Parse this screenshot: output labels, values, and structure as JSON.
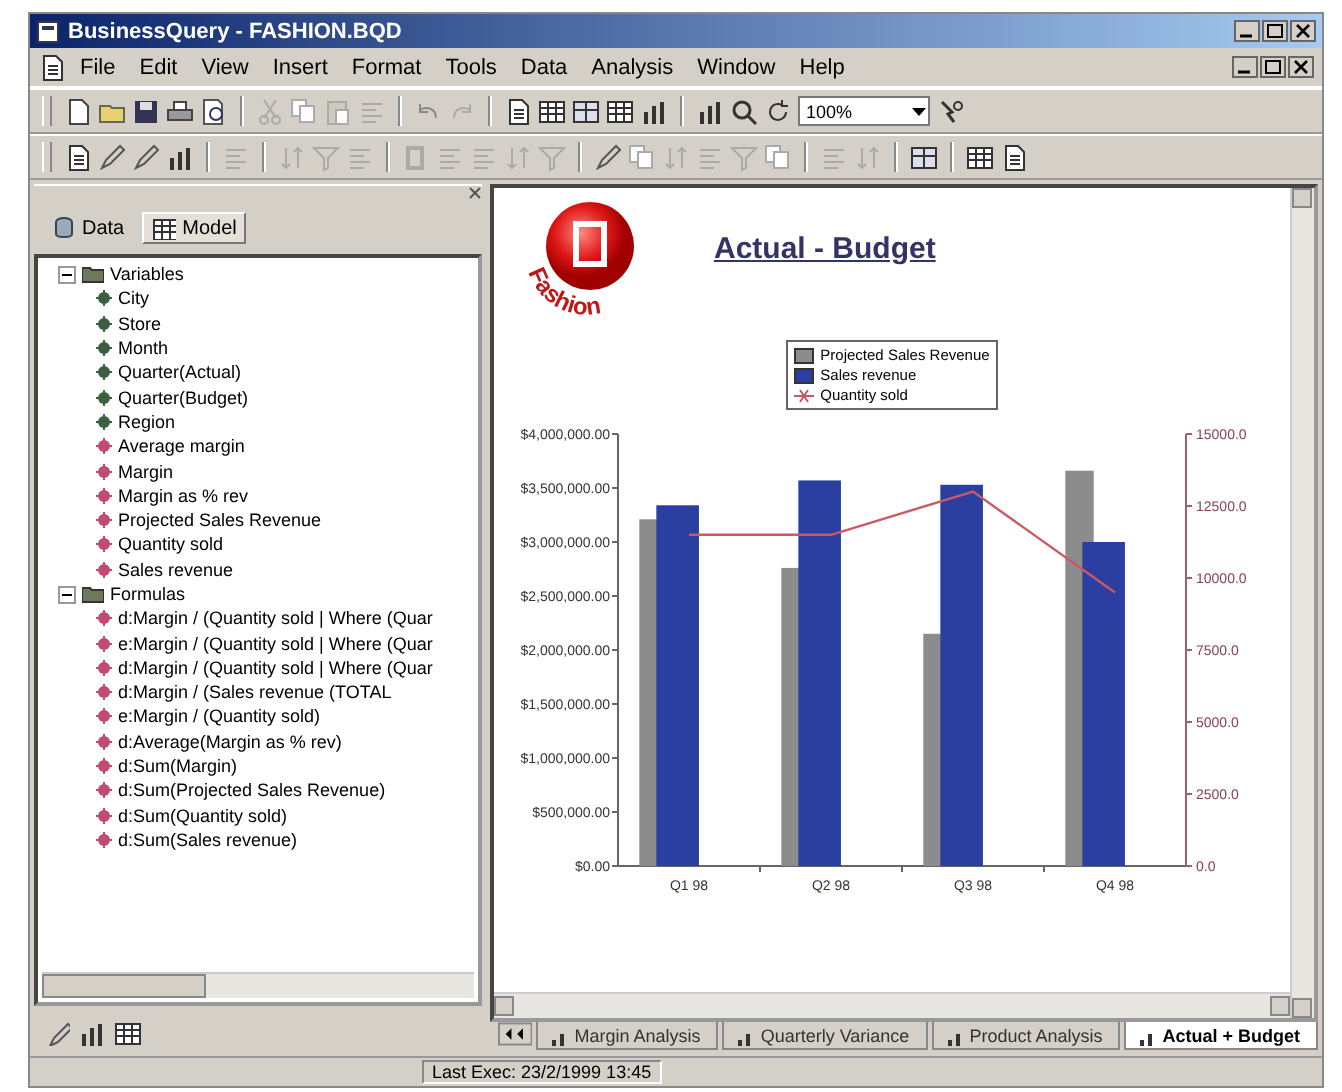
{
  "window": {
    "title": "BusinessQuery - FASHION.BQD"
  },
  "menu": [
    "File",
    "Edit",
    "View",
    "Insert",
    "Format",
    "Tools",
    "Data",
    "Analysis",
    "Window",
    "Help"
  ],
  "toolbar": {
    "zoom": "100%"
  },
  "panel": {
    "tabs": [
      {
        "label": "Data",
        "selected": false
      },
      {
        "label": "Model",
        "selected": true
      }
    ],
    "tree": [
      {
        "label": "Variables",
        "expanded": true,
        "children": [
          {
            "label": "City",
            "kind": "dimension"
          },
          {
            "label": "Store",
            "kind": "dimension"
          },
          {
            "label": "Month",
            "kind": "dimension"
          },
          {
            "label": "Quarter(Actual)",
            "kind": "dimension"
          },
          {
            "label": "Quarter(Budget)",
            "kind": "dimension"
          },
          {
            "label": "Region",
            "kind": "dimension"
          },
          {
            "label": "Average margin",
            "kind": "measure"
          },
          {
            "label": "Margin",
            "kind": "measure"
          },
          {
            "label": "Margin as % rev",
            "kind": "measure"
          },
          {
            "label": "Projected Sales Revenue",
            "kind": "measure"
          },
          {
            "label": "Quantity sold",
            "kind": "measure"
          },
          {
            "label": "Sales revenue",
            "kind": "measure"
          }
        ]
      },
      {
        "label": "Formulas",
        "expanded": true,
        "children": [
          {
            "label": "d:Margin / (Quantity sold | Where (Quar",
            "kind": "measure"
          },
          {
            "label": "e:Margin / (Quantity sold | Where (Quar",
            "kind": "measure"
          },
          {
            "label": "d:Margin / (Quantity sold | Where (Quar",
            "kind": "measure"
          },
          {
            "label": "d:Margin / (Sales revenue (TOTAL",
            "kind": "measure"
          },
          {
            "label": "e:Margin / (Quantity sold)",
            "kind": "measure"
          },
          {
            "label": "d:Average(Margin as % rev)",
            "kind": "measure"
          },
          {
            "label": "d:Sum(Margin)",
            "kind": "measure"
          },
          {
            "label": "d:Sum(Projected Sales Revenue)",
            "kind": "measure"
          },
          {
            "label": "d:Sum(Quantity sold)",
            "kind": "measure"
          },
          {
            "label": "d:Sum(Sales revenue)",
            "kind": "measure"
          }
        ]
      }
    ]
  },
  "report": {
    "logo_text": "Fashion",
    "title": "Actual - Budget",
    "chart_data": {
      "type": "bar",
      "categories": [
        "Q1 98",
        "Q2 98",
        "Q3 98",
        "Q4 98"
      ],
      "series": [
        {
          "name": "Projected Sales Revenue",
          "color": "#8c8c8c",
          "values": [
            3210000,
            2760000,
            2150000,
            3660000
          ]
        },
        {
          "name": "Sales revenue",
          "color": "#2b3fa0",
          "values": [
            3340000,
            3570000,
            3530000,
            3000000
          ]
        },
        {
          "name": "Quantity sold",
          "type": "line",
          "axis": "y2",
          "color": "#c85a64",
          "values": [
            11500,
            11500,
            13000,
            9500
          ]
        }
      ],
      "ylim": [
        0,
        4000000
      ],
      "yticks": [
        {
          "value": 0,
          "label": "$0.00"
        },
        {
          "value": 500000,
          "label": "$500,000.00"
        },
        {
          "value": 1000000,
          "label": "$1,000,000.00"
        },
        {
          "value": 1500000,
          "label": "$1,500,000.00"
        },
        {
          "value": 2000000,
          "label": "$2,000,000.00"
        },
        {
          "value": 2500000,
          "label": "$2,500,000.00"
        },
        {
          "value": 3000000,
          "label": "$3,000,000.00"
        },
        {
          "value": 3500000,
          "label": "$3,500,000.00"
        },
        {
          "value": 4000000,
          "label": "$4,000,000.00"
        }
      ],
      "y2lim": [
        0,
        15000
      ],
      "y2ticks": [
        {
          "value": 0,
          "label": "0.0"
        },
        {
          "value": 2500,
          "label": "2500.0"
        },
        {
          "value": 5000,
          "label": "5000.0"
        },
        {
          "value": 7500,
          "label": "7500.0"
        },
        {
          "value": 10000,
          "label": "10000.0"
        },
        {
          "value": 12500,
          "label": "12500.0"
        },
        {
          "value": 15000,
          "label": "15000.0"
        }
      ]
    }
  },
  "sheet_tabs": [
    {
      "label": "Margin Analysis",
      "selected": false
    },
    {
      "label": "Quarterly Variance",
      "selected": false
    },
    {
      "label": "Product Analysis",
      "selected": false
    },
    {
      "label": "Actual + Budget",
      "selected": true
    }
  ],
  "status_bar": {
    "text": "Last Exec: 23/2/1999 13:45"
  }
}
